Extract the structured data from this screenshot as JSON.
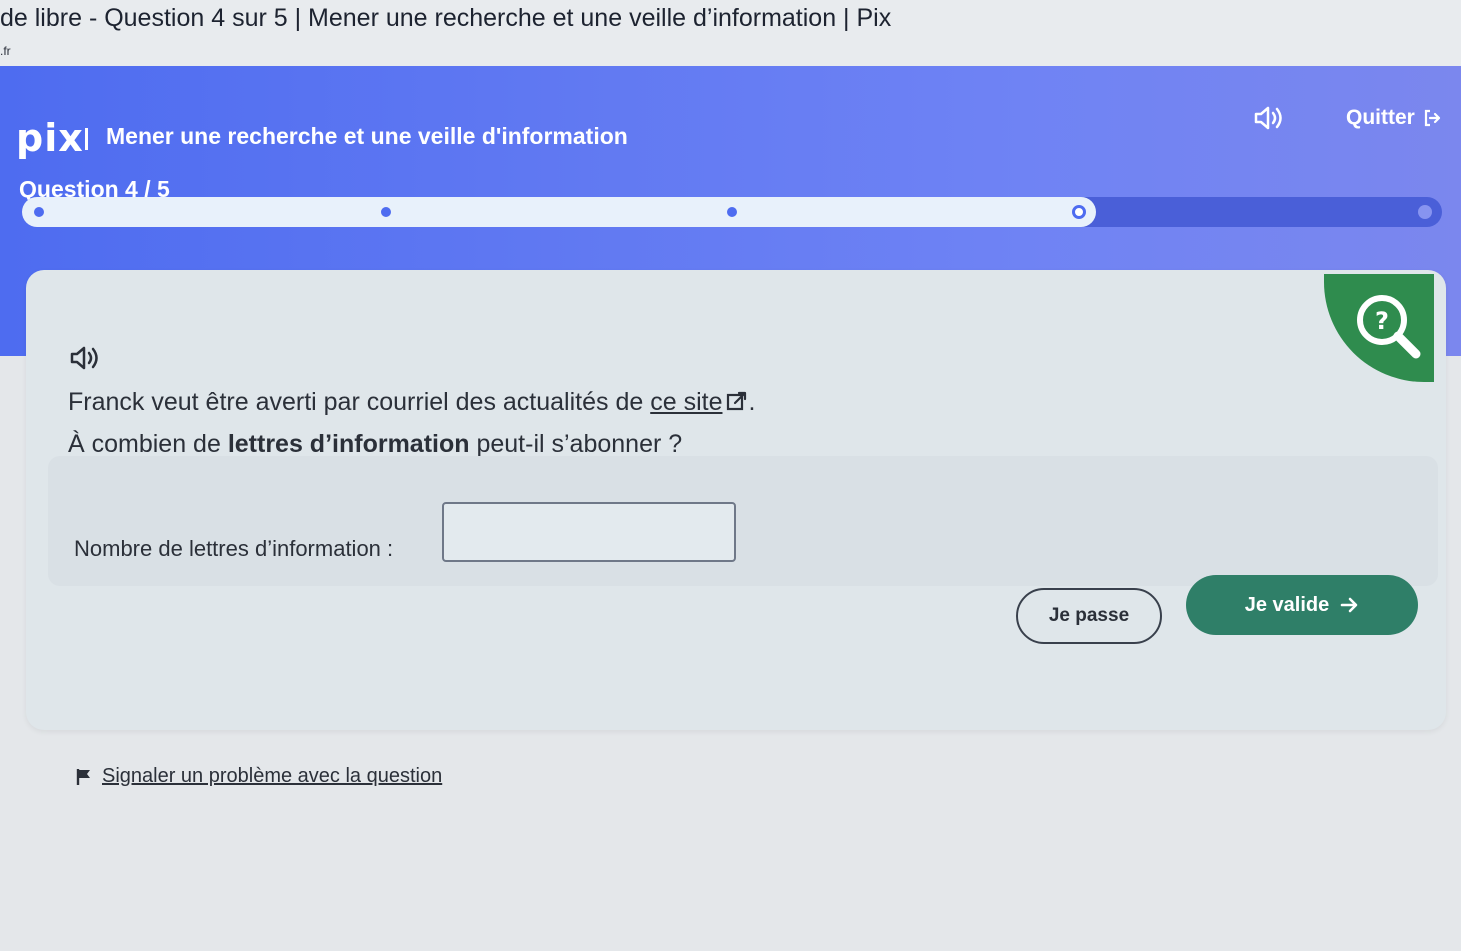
{
  "browser": {
    "tab_title": "de libre - Question 4 sur 5 | Mener une recherche et une veille d’information | Pix",
    "url_fragment": ".fr"
  },
  "header": {
    "logo": "pix",
    "title": "Mener une recherche et une veille d'information",
    "quit_label": "Quitter",
    "question_label": "Question 4 / 5",
    "progress": {
      "current": 4,
      "total": 5
    }
  },
  "challenge": {
    "instruction_line1_prefix": "Franck veut être averti par courriel des actualités de ",
    "instruction_link": "ce site",
    "instruction_line1_suffix": ".",
    "instruction_line2_prefix": "À combien de ",
    "instruction_line2_bold": "lettres d’information",
    "instruction_line2_suffix": " peut-il s’abonner ?",
    "answer_label": "Nombre de lettres d’information :",
    "answer_value": "",
    "skip_label": "Je passe",
    "validate_label": "Je valide",
    "report_label": "Signaler un problème avec la question"
  },
  "icons": {
    "speaker": "speaker-icon",
    "quit": "exit-icon",
    "help": "help-magnifier-icon",
    "external_link": "external-link-icon",
    "arrow": "arrow-right-icon",
    "flag": "flag-icon"
  },
  "colors": {
    "header_blue": "#4e6cf0",
    "validate_green": "#2f7f68",
    "help_green": "#2f8c4e"
  }
}
